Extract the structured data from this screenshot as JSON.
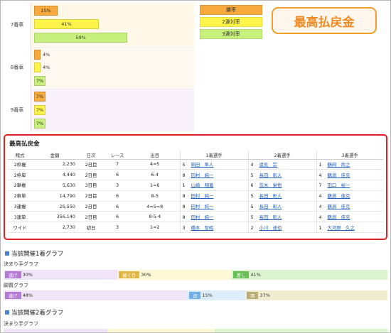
{
  "top_chart": {
    "rows": [
      {
        "label": "7番車",
        "bars": [
          {
            "type": "win",
            "text": "15%",
            "value": 15
          },
          {
            "type": "place2",
            "text": "41%",
            "value": 41
          },
          {
            "type": "place3",
            "text": "59%",
            "value": 59
          }
        ]
      },
      {
        "label": "8番車",
        "bars": [
          {
            "type": "win",
            "text": "4%",
            "value": 4
          },
          {
            "type": "place2",
            "text": "4%",
            "value": 4
          },
          {
            "type": "place3",
            "text": "7%",
            "value": 7
          }
        ]
      },
      {
        "label": "9番車",
        "bars": [
          {
            "type": "win",
            "text": "7%",
            "value": 7
          },
          {
            "type": "place2",
            "text": "7%",
            "value": 7
          },
          {
            "type": "place3",
            "text": "7%",
            "value": 7
          }
        ]
      }
    ],
    "legend": [
      {
        "label": "勝率",
        "color": "#f7a93b"
      },
      {
        "label": "2連対率",
        "color": "#fff54a"
      },
      {
        "label": "3連対率",
        "color": "#c8f07c"
      }
    ]
  },
  "callout": {
    "text": "最高払戻金"
  },
  "payout": {
    "title": "最高払戻金",
    "headers": [
      "賭式",
      "金額",
      "日次",
      "レース",
      "出目",
      "1着選手",
      "2着選手",
      "3着選手"
    ],
    "rows": [
      {
        "type": "2枠複",
        "amount": "2,230",
        "day": "2日目",
        "race": "7",
        "result": "4=5",
        "n1": "5",
        "p1": "岡田　隼人",
        "n2": "4",
        "p2": "遠見　宗",
        "n3": "1",
        "p3": "鶴岡　尚之"
      },
      {
        "type": "2枠単",
        "amount": "4,440",
        "day": "2日目",
        "race": "6",
        "result": "6-4",
        "n1": "8",
        "p1": "田村　純一",
        "n2": "5",
        "p2": "長田　彰人",
        "n3": "4",
        "p3": "鶴渕　佳克"
      },
      {
        "type": "2車複",
        "amount": "5,630",
        "day": "3日目",
        "race": "3",
        "result": "1=6",
        "n1": "1",
        "p1": "山崎　翔寛",
        "n2": "6",
        "p2": "茨木　栄悟",
        "n3": "7",
        "p3": "田口　裕一"
      },
      {
        "type": "2車単",
        "amount": "14,790",
        "day": "2日目",
        "race": "6",
        "result": "8-5",
        "n1": "8",
        "p1": "田村　純一",
        "n2": "5",
        "p2": "長田　彰人",
        "n3": "4",
        "p3": "鶴渕　佳克"
      },
      {
        "type": "3連複",
        "amount": "25,550",
        "day": "2日目",
        "race": "6",
        "result": "4=5=8",
        "n1": "8",
        "p1": "田村　純一",
        "n2": "5",
        "p2": "長田　彰人",
        "n3": "4",
        "p3": "鶴渕　佳克"
      },
      {
        "type": "3連単",
        "amount": "356,140",
        "day": "2日目",
        "race": "6",
        "result": "8-5-4",
        "n1": "8",
        "p1": "田村　純一",
        "n2": "5",
        "p2": "長田　彰人",
        "n3": "4",
        "p3": "鶴渕　佳克"
      },
      {
        "type": "ワイド",
        "amount": "2,730",
        "day": "初日",
        "race": "3",
        "result": "1=2",
        "n1": "3",
        "p1": "橋本　智昭",
        "n2": "2",
        "p2": "小川　達也",
        "n3": "1",
        "p3": "大河原　久之"
      }
    ]
  },
  "graph1": {
    "title": "当該開催1着グラフ",
    "kimarite_label": "決まり手グラフ",
    "kimarite": [
      {
        "tag": "逃げ",
        "text": "30%",
        "value": 30,
        "bg": "#f0e4f8",
        "tagbg": "#b37bd6"
      },
      {
        "tag": "捲くり",
        "text": "30%",
        "value": 30,
        "bg": "#fff8d6",
        "tagbg": "#e0b84a"
      },
      {
        "tag": "差し",
        "text": "41%",
        "value": 41,
        "bg": "#dcf5d0",
        "tagbg": "#6cc05a"
      }
    ],
    "kyakushitsu_label": "脚質グラフ",
    "kyakushitsu": [
      {
        "tag": "逃げ",
        "text": "48%",
        "value": 48,
        "bg": "#f0e4f8",
        "tagbg": "#b37bd6"
      },
      {
        "tag": "追",
        "text": "15%",
        "value": 15,
        "bg": "#ddeefa",
        "tagbg": "#6fb1e6"
      },
      {
        "tag": "両",
        "text": "37%",
        "value": 37,
        "bg": "#f2edcf",
        "tagbg": "#b9ad78"
      }
    ]
  },
  "graph2": {
    "title": "当該開催2着グラフ",
    "kimarite_label": "決まり手グラフ"
  }
}
